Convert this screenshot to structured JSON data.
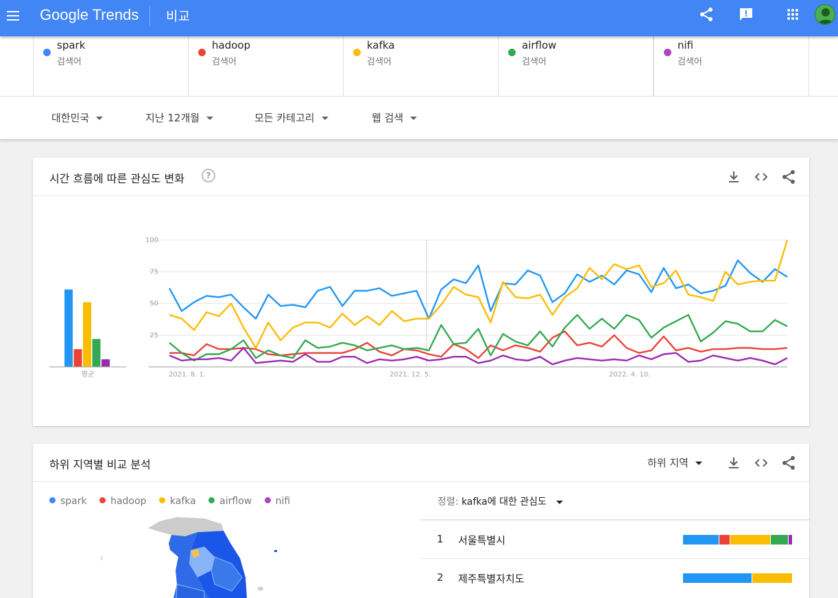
{
  "header": {
    "brand_google": "Google",
    "brand_trends": "Trends",
    "page_title": "비교"
  },
  "terms": [
    {
      "name": "spark",
      "sub": "검색어",
      "color": "#4285f4"
    },
    {
      "name": "hadoop",
      "sub": "검색어",
      "color": "#ea4335"
    },
    {
      "name": "kafka",
      "sub": "검색어",
      "color": "#fbbc04"
    },
    {
      "name": "airflow",
      "sub": "검색어",
      "color": "#34a853"
    },
    {
      "name": "nifi",
      "sub": "검색어",
      "color": "#ab47bc"
    }
  ],
  "filters": {
    "region": "대한민국",
    "period": "지난 12개월",
    "category": "모든 카테고리",
    "search_type": "웹 검색"
  },
  "interest_card": {
    "title": "시간 흐름에 따른 관심도 변화",
    "help": "?",
    "average_label": "평균"
  },
  "chart_data": {
    "type": "line",
    "x_labels": [
      "2021. 8. 1.",
      "2021. 12. 5.",
      "2022. 4. 10."
    ],
    "yticks": [
      "100",
      "75",
      "50",
      "25"
    ],
    "ylim": [
      0,
      100
    ],
    "averages": [
      {
        "name": "spark",
        "value": 61
      },
      {
        "name": "hadoop",
        "value": 14
      },
      {
        "name": "kafka",
        "value": 51
      },
      {
        "name": "airflow",
        "value": 22
      },
      {
        "name": "nifi",
        "value": 6
      }
    ],
    "series": [
      {
        "name": "spark",
        "color": "#2196f3",
        "values": [
          62,
          44,
          51,
          56,
          55,
          57,
          47,
          38,
          57,
          48,
          49,
          47,
          60,
          63,
          48,
          60,
          60,
          62,
          56,
          58,
          60,
          38,
          61,
          69,
          66,
          80,
          44,
          66,
          65,
          76,
          72,
          51,
          58,
          73,
          67,
          72,
          65,
          76,
          73,
          59,
          78,
          62,
          65,
          58,
          60,
          64,
          84,
          74,
          67,
          77,
          71
        ]
      },
      {
        "name": "hadoop",
        "color": "#ea4335",
        "values": [
          11,
          11,
          9,
          18,
          14,
          14,
          15,
          14,
          10,
          9,
          10,
          11,
          11,
          11,
          11,
          14,
          19,
          12,
          9,
          14,
          13,
          10,
          8,
          18,
          14,
          7,
          17,
          13,
          17,
          15,
          12,
          23,
          28,
          17,
          19,
          16,
          25,
          15,
          11,
          13,
          24,
          13,
          15,
          12,
          14,
          14,
          15,
          15,
          14,
          14,
          15
        ]
      },
      {
        "name": "kafka",
        "color": "#fbbc04",
        "values": [
          41,
          38,
          29,
          43,
          40,
          50,
          31,
          15,
          35,
          21,
          31,
          35,
          35,
          31,
          42,
          33,
          40,
          33,
          44,
          36,
          38,
          38,
          49,
          63,
          57,
          55,
          35,
          67,
          55,
          54,
          57,
          41,
          55,
          62,
          78,
          69,
          81,
          77,
          80,
          63,
          66,
          76,
          57,
          55,
          52,
          75,
          65,
          67,
          68,
          68,
          100
        ]
      },
      {
        "name": "airflow",
        "color": "#34a853",
        "values": [
          19,
          11,
          5,
          10,
          10,
          14,
          21,
          7,
          13,
          9,
          7,
          21,
          15,
          16,
          19,
          17,
          13,
          15,
          17,
          14,
          15,
          13,
          33,
          18,
          19,
          30,
          9,
          26,
          20,
          17,
          28,
          16,
          31,
          41,
          30,
          38,
          30,
          41,
          37,
          23,
          31,
          36,
          41,
          20,
          27,
          36,
          34,
          28,
          28,
          37,
          32
        ]
      },
      {
        "name": "nifi",
        "color": "#9c27b0",
        "values": [
          9,
          5,
          6,
          6,
          7,
          5,
          15,
          3,
          4,
          5,
          4,
          10,
          4,
          4,
          8,
          8,
          3,
          6,
          5,
          6,
          8,
          5,
          6,
          8,
          8,
          3,
          5,
          9,
          6,
          5,
          8,
          2,
          5,
          7,
          6,
          5,
          6,
          5,
          9,
          6,
          10,
          11,
          4,
          5,
          9,
          7,
          5,
          7,
          5,
          2,
          7
        ]
      }
    ]
  },
  "region_card": {
    "title": "하위 지역별 비교 분석",
    "dropdown_label": "하위 지역",
    "sort_label": "정렬:",
    "sort_value": "kafka에 대한 관심도",
    "rows": [
      {
        "rank": "1",
        "name": "서울특별시",
        "shares": [
          33,
          10,
          37,
          16,
          4
        ]
      },
      {
        "rank": "2",
        "name": "제주특별자치도",
        "shares": [
          63,
          0,
          37,
          0,
          0
        ]
      }
    ]
  }
}
